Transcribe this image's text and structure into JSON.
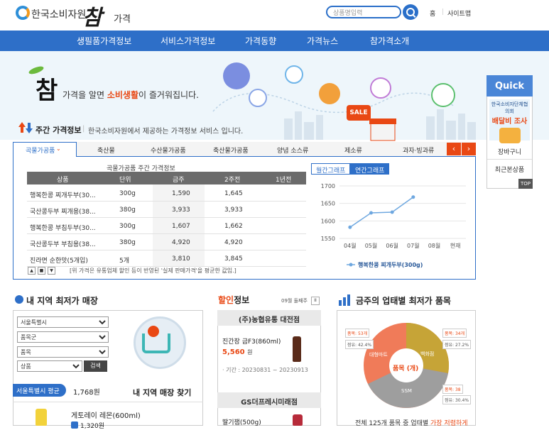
{
  "header": {
    "org_name": "한국소비자원",
    "logo_big": "참",
    "logo_small": "가격",
    "search_placeholder": "상품명입력",
    "util_home": "홈",
    "util_sitemap": "사이트맵"
  },
  "nav": [
    "생필품가격정보",
    "서비스가격정보",
    "가격동향",
    "가격뉴스",
    "참가격소개"
  ],
  "banner": {
    "brand": "참",
    "slogan_pre": "가격을 알면 ",
    "slogan_em": "소비생활",
    "slogan_post": "이 즐거워집니다.",
    "sale_badge": "SALE"
  },
  "quick": {
    "title": "Quick",
    "promo_line1": "한국소비자단체협의회",
    "promo_line2": "배달비 조사",
    "items": [
      "장바구니",
      "최근본상품"
    ],
    "top": "TOP"
  },
  "weekly": {
    "title": "주간 가격정보",
    "desc": "한국소비자원에서 제공하는 가격정보 서비스 입니다.",
    "tabs": [
      "곡물가공품",
      "축산물",
      "수산물가공품",
      "축산물가공품",
      "양념 소스류",
      "제소류",
      "과자·빙과류"
    ],
    "table_title": "곡물가공품 주간 가격정보",
    "columns": [
      "상품",
      "단위",
      "금주",
      "2주전",
      "1년전"
    ],
    "rows": [
      [
        "행복한콩 찌개두부(30...",
        "300g",
        "1,590",
        "1,645",
        ""
      ],
      [
        "국산콩두부 찌개용(38...",
        "380g",
        "3,933",
        "3,933",
        ""
      ],
      [
        "행복한콩 부침두부(30...",
        "300g",
        "1,607",
        "1,662",
        ""
      ],
      [
        "국산콩두부 부침용(38...",
        "380g",
        "4,920",
        "4,920",
        ""
      ],
      [
        "진라면 순한맛(5개입)",
        "5개",
        "3,810",
        "3,845",
        ""
      ]
    ],
    "note": "[위 가격은 유통업체 할인 등이 반영된 '실제 판매가격'을 평균한 값임.]",
    "graph_tabs": [
      "월간그래프",
      "연간그래프"
    ]
  },
  "chart_data": {
    "type": "line",
    "categories": [
      "04월",
      "05월",
      "06월",
      "07월",
      "08월",
      "현재"
    ],
    "series": [
      {
        "name": "행복한콩 찌개두부(300g)",
        "values": [
          1582,
          1623,
          1625,
          1668,
          null,
          null
        ]
      }
    ],
    "yticks": [
      1550,
      1600,
      1650,
      1700
    ],
    "ylim": [
      1550,
      1700
    ],
    "grid": true,
    "legend": "bottom",
    "color": "#6fa8e0"
  },
  "region": {
    "title": "내 지역 최저가 매장",
    "selects": [
      "서울특별시",
      "품목군",
      "품목",
      "상품"
    ],
    "search_btn": "검색",
    "avg_label": "서울특별시 평균가",
    "avg_value": "1,768원",
    "find_label": "내 지역 매장 찾기",
    "item_name": "게토레이 레몬(600ml)",
    "item_price": "1,320원"
  },
  "sale": {
    "title_pre": "할인",
    "title_post": "정보",
    "week": "09월 둘째주",
    "store1": "(주)농협유통 대전점",
    "product1": "진간장 금F3(860ml)",
    "price1": "5,560",
    "won": "원",
    "period1": "· 기간 : 20230831 ~ 20230913",
    "store2": "GS더프레시미래점",
    "product2": "딸기잼(500g)"
  },
  "best": {
    "title": "금주의 업태별 최저가 품목",
    "center": "품목 (개)",
    "segments": [
      "대형마트",
      "백화점",
      "SSM"
    ],
    "badges": [
      "품목: 53개",
      "점유: 42.4%",
      "품목: 34개",
      "점유: 27.2%",
      "품목: 38",
      "점유: 30.4%"
    ],
    "footer_pre": "전체 125개 품목 중 업태별 ",
    "footer_em": "가장 저렴하게"
  }
}
